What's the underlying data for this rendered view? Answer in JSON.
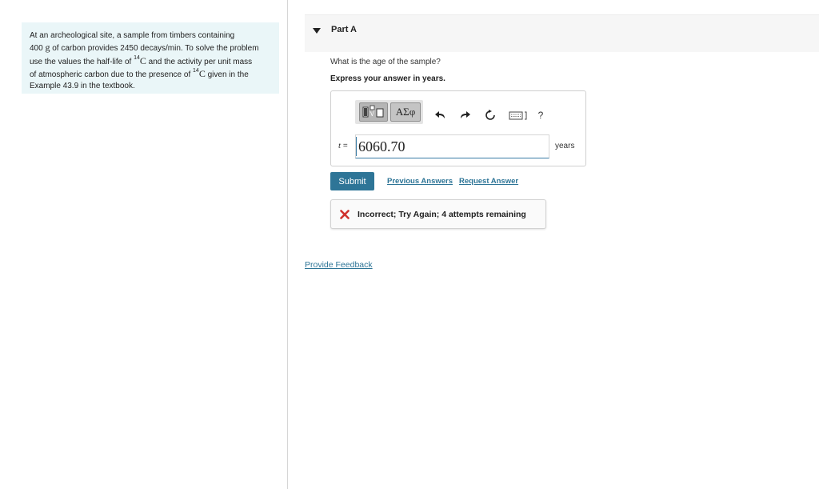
{
  "problem": {
    "text_1": "At an archeological site, a sample from timbers containing",
    "text_2a": "400 ",
    "text_2_unit": "g",
    "text_2b": " of carbon provides 2450 decays/min. To solve the problem",
    "text_3a": "use the values the half-life of ",
    "isotope_mass": "14",
    "isotope_symbol": "C",
    "text_3b": " and the activity per unit mass",
    "text_4a": "of atmospheric carbon due to the presence of ",
    "text_4b": " given in the",
    "text_5": "Example 43.9 in the textbook."
  },
  "part": {
    "title": "Part A",
    "question": "What is the age of the sample?",
    "instruction": "Express your answer in years."
  },
  "toolbar": {
    "greek_label": "ΑΣφ",
    "help_label": "?",
    "icons": [
      "matrix-template-icon",
      "undo-icon",
      "redo-icon",
      "reset-icon",
      "keyboard-icon",
      "help-icon"
    ]
  },
  "answer": {
    "variable": "t",
    "equals": " =",
    "value": "6060.70",
    "unit": "years"
  },
  "actions": {
    "submit_label": "Submit",
    "previous_answers_label": "Previous Answers",
    "request_answer_label": "Request Answer"
  },
  "feedback": {
    "message": "Incorrect; Try Again; 4 attempts remaining",
    "status_color": "#d0312d"
  },
  "footer": {
    "provide_feedback_label": "Provide Feedback"
  },
  "colors": {
    "accent": "#2e7597",
    "problem_background": "#eaf6f8"
  }
}
